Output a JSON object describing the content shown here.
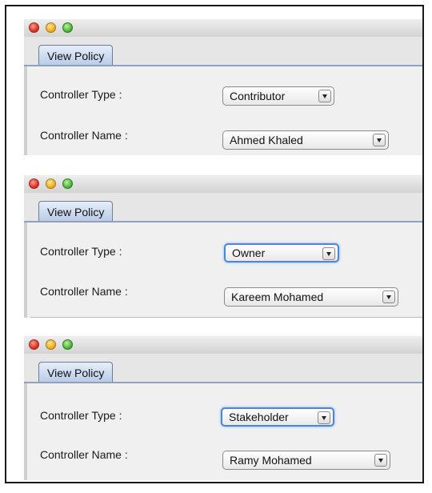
{
  "panels": [
    {
      "tab_label": "View Policy",
      "type_label": "Controller Type :",
      "type_value": "Contributor",
      "name_label": "Controller Name :",
      "name_value": "Ahmed Khaled"
    },
    {
      "tab_label": "View Policy",
      "type_label": "Controller Type :",
      "type_value": "Owner",
      "name_label": "Controller Name :",
      "name_value": "Kareem Mohamed"
    },
    {
      "tab_label": "View Policy",
      "type_label": "Controller Type :",
      "type_value": "Stakeholder",
      "name_label": "Controller Name :",
      "name_value": "Ramy Mohamed"
    }
  ],
  "icons": [
    "close-icon",
    "minimize-icon",
    "zoom-icon",
    "chevron-down-icon"
  ]
}
